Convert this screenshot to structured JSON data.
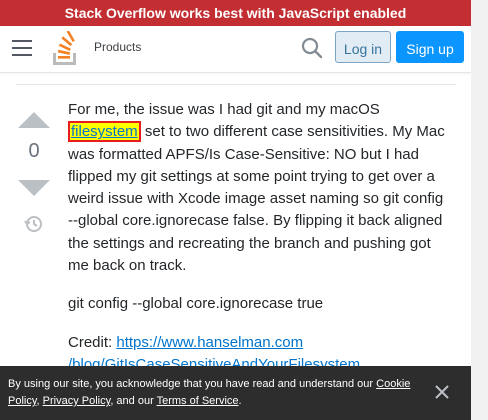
{
  "banner": {
    "text": "Stack Overflow works best with JavaScript enabled"
  },
  "header": {
    "products_label": "Products",
    "login_label": "Log in",
    "signup_label": "Sign up"
  },
  "vote": {
    "count": "0"
  },
  "post": {
    "p1_before": "For me, the issue was I had git and my macOS ",
    "p1_highlight": "filesystem",
    "p1_after": " set to two different case sensitivities. My Mac was formatted APFS/Is Case-Sensitive: NO but I had flipped my git settings at some point trying to get over a weird issue with Xcode image asset naming so git config --global core.ignorecase false. By flipping it back aligned the settings and recreating the branch and pushing got me back on track.",
    "p2": "git config --global core.ignorecase true",
    "credit_label": "Credit: ",
    "credit_link": "https://www.hanselman.com",
    "credit_link_cont": "/blog/GitIsCaseSensitiveAndYourFilesystem MayNotBeWe"
  },
  "cookie": {
    "text_1": "By using our site, you acknowledge that you have read and understand our ",
    "cookie_policy": "Cookie Policy",
    "sep1": ", ",
    "privacy_policy": "Privacy Policy",
    "text_2": ", and our ",
    "terms": "Terms of Service",
    "end": "."
  },
  "colors": {
    "banner_bg": "#c22e32",
    "signup_bg": "#0a95ff",
    "login_bg": "#e1ecf4",
    "link": "#0074cc",
    "highlight_bg": "#ffff00",
    "highlight_border": "#e81c1c",
    "cookie_bg": "#2d2d2d"
  },
  "icons": [
    "hamburger-icon",
    "stackoverflow-logo",
    "search-icon",
    "vote-up-icon",
    "vote-down-icon",
    "history-icon",
    "close-icon"
  ]
}
